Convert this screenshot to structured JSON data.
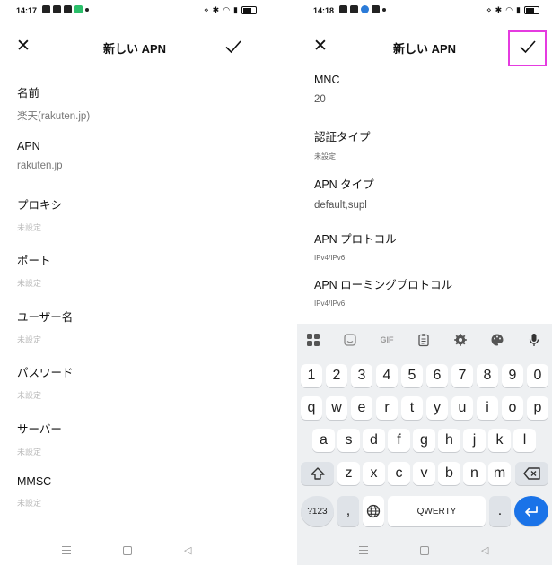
{
  "left": {
    "status": {
      "time": "14:17"
    },
    "appbar": {
      "title": "新しい APN"
    },
    "fields": [
      {
        "label": "名前",
        "value": "楽天(rakuten.jp)"
      },
      {
        "label": "APN",
        "value": "rakuten.jp"
      },
      {
        "label": "プロキシ",
        "value": "未設定"
      },
      {
        "label": "ポート",
        "value": "未設定"
      },
      {
        "label": "ユーザー名",
        "value": "未設定"
      },
      {
        "label": "パスワード",
        "value": "未設定"
      },
      {
        "label": "サーバー",
        "value": "未設定"
      },
      {
        "label": "MMSC",
        "value": "未設定"
      }
    ]
  },
  "right": {
    "status": {
      "time": "14:18"
    },
    "appbar": {
      "title": "新しい APN"
    },
    "fields": [
      {
        "label": "MNC",
        "value": "20"
      },
      {
        "label": "認証タイプ",
        "value": "未設定"
      },
      {
        "label": "APN タイプ",
        "value": "default,supl"
      },
      {
        "label": "APN プロトコル",
        "value": "IPv4/IPv6"
      },
      {
        "label": "APN ローミングプロトコル",
        "value": "IPv4/IPv6"
      }
    ],
    "keyboard": {
      "toolbar": {
        "gif": "GIF"
      },
      "row_numbers": [
        "1",
        "2",
        "3",
        "4",
        "5",
        "6",
        "7",
        "8",
        "9",
        "0"
      ],
      "row_q": [
        "q",
        "w",
        "e",
        "r",
        "t",
        "y",
        "u",
        "i",
        "o",
        "p"
      ],
      "row_a": [
        "a",
        "s",
        "d",
        "f",
        "g",
        "h",
        "j",
        "k",
        "l"
      ],
      "row_z": [
        "z",
        "x",
        "c",
        "v",
        "b",
        "n",
        "m"
      ],
      "symbols_label": "?123",
      "comma": ",",
      "space_label": "QWERTY",
      "period": "."
    }
  },
  "colors": {
    "highlight": "#e53be0",
    "enter": "#1a73e8"
  }
}
